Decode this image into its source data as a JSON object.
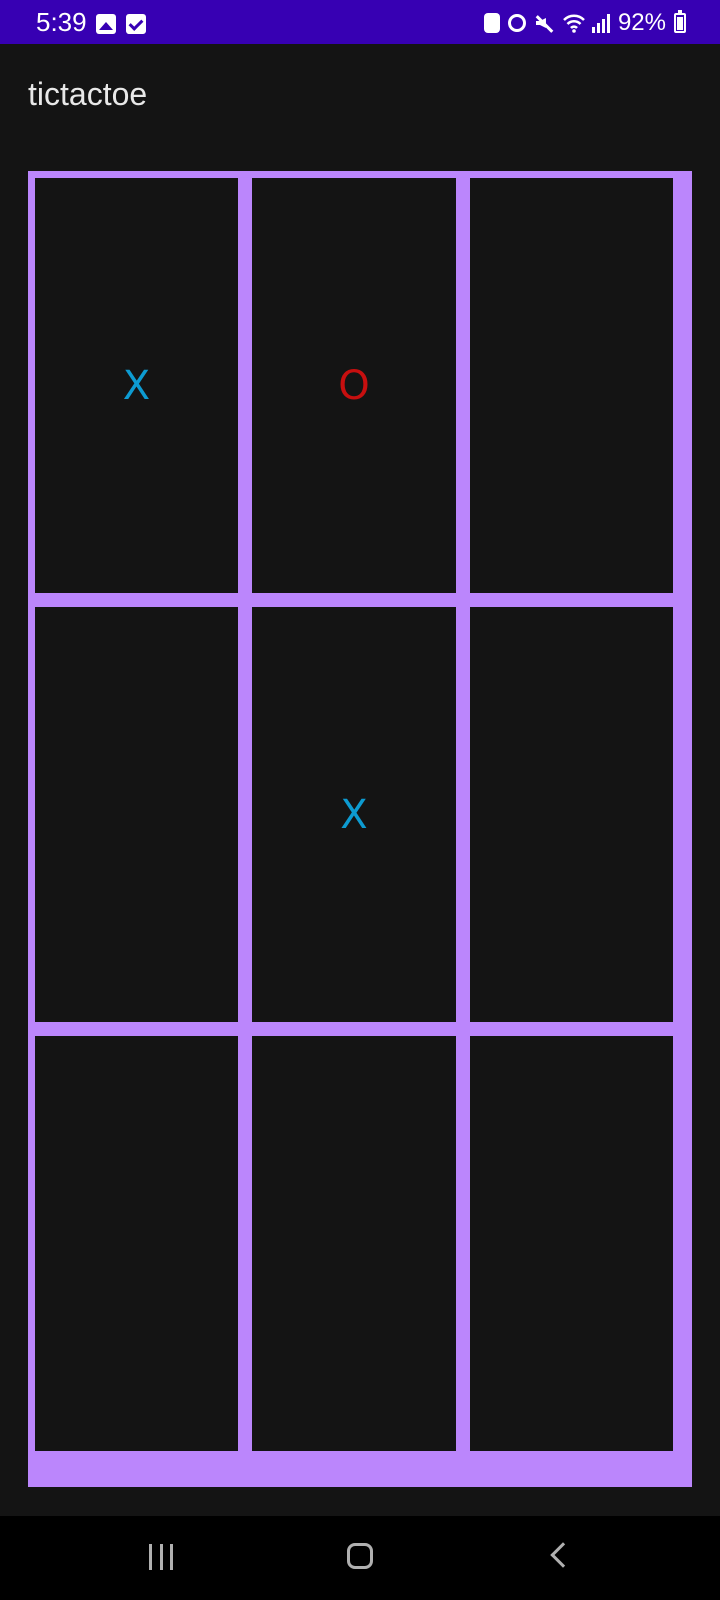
{
  "status_bar": {
    "time": "5:39",
    "battery_percent": "92%",
    "background_color": "#3700b3",
    "left_icons": [
      "image-notification-icon",
      "checkbox-notification-icon"
    ],
    "right_icons": [
      "recycle-icon",
      "alarm-icon",
      "mute-icon",
      "wifi-icon",
      "signal-icon",
      "battery-charging-icon"
    ]
  },
  "app": {
    "title": "tictactoe"
  },
  "board": {
    "grid_color": "#bb86fc",
    "x_color": "#0d9bd1",
    "o_color": "#c70f0f",
    "cells": [
      {
        "value": "X"
      },
      {
        "value": "O"
      },
      {
        "value": ""
      },
      {
        "value": ""
      },
      {
        "value": "X"
      },
      {
        "value": ""
      },
      {
        "value": ""
      },
      {
        "value": ""
      },
      {
        "value": ""
      }
    ]
  },
  "nav_bar": {
    "buttons": [
      "recents-button",
      "home-button",
      "back-button"
    ]
  }
}
